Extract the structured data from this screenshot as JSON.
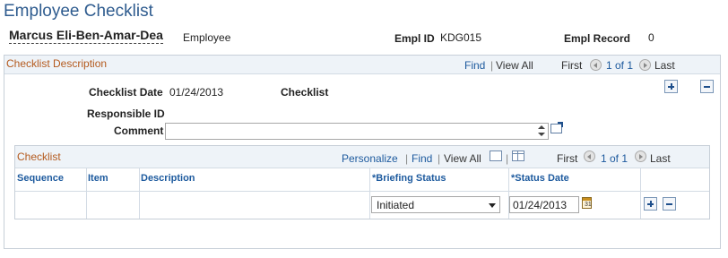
{
  "page": {
    "title": "Employee Checklist"
  },
  "employee": {
    "name": "Marcus Eli-Ben-Amar-Dea",
    "type": "Employee",
    "empl_id_label": "Empl ID",
    "empl_id": "KDG015",
    "empl_record_label": "Empl Record",
    "empl_record": "0"
  },
  "checklist_group": {
    "caption": "Checklist Description",
    "find": "Find",
    "sep": "|",
    "view_all": "View All",
    "first": "First",
    "page_of": "1 of 1",
    "last": "Last"
  },
  "fields": {
    "checklist_date_label": "Checklist Date",
    "checklist_date": "01/24/2013",
    "checklist_label": "Checklist",
    "responsible_id_label": "Responsible ID",
    "comment_label": "Comment",
    "comment_value": ""
  },
  "grid": {
    "caption": "Checklist",
    "personalize": "Personalize",
    "find": "Find",
    "view_all": "View All",
    "sep": "|",
    "first": "First",
    "page_of": "1 of 1",
    "last": "Last",
    "columns": [
      "Sequence",
      "Item",
      "Description",
      "*Briefing Status",
      "*Status Date"
    ],
    "rows": [
      {
        "sequence": "",
        "item": "",
        "description": "",
        "briefing_status": "Initiated",
        "status_date": "01/24/2013"
      }
    ]
  },
  "icons": {
    "add": "plus-icon",
    "remove": "minus-icon",
    "prev": "prev-arrow-icon",
    "next": "next-arrow-icon",
    "popout": "popout-icon",
    "calendar": "calendar-icon",
    "spreadsheet": "spreadsheet-icon"
  },
  "colors": {
    "title": "#2f5c8f",
    "link": "#1d5a9e",
    "caption": "#b45a1e",
    "header_bg": "#eef3f8"
  }
}
